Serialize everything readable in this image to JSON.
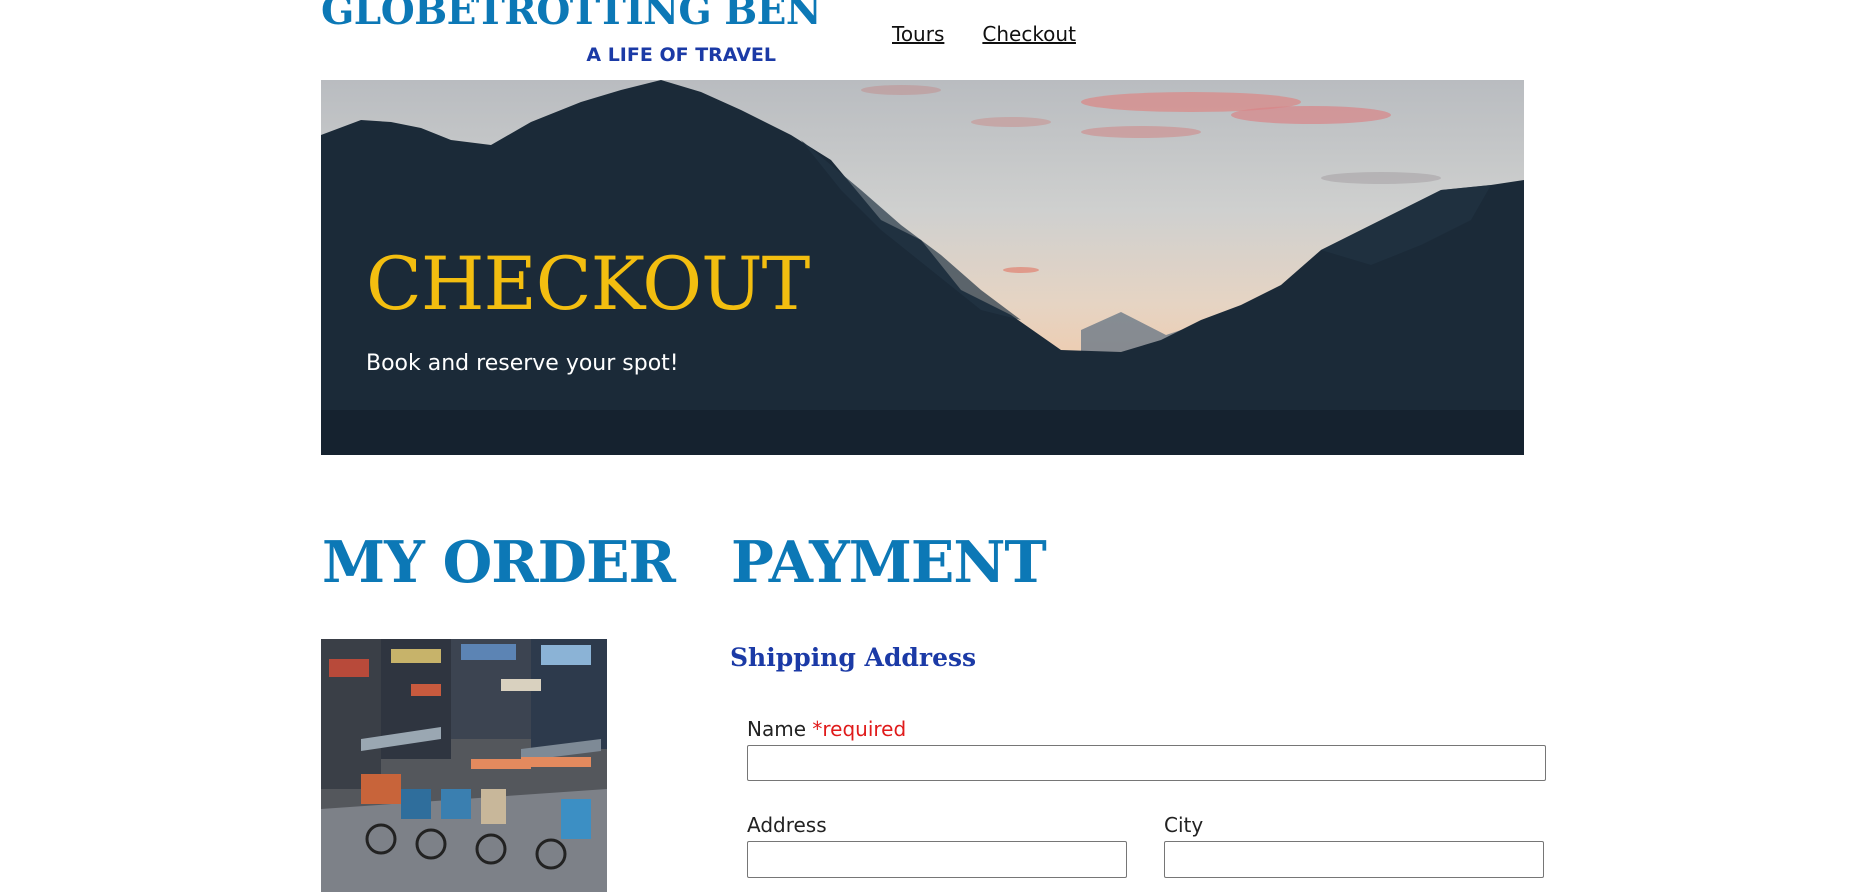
{
  "header": {
    "logo_title": "GLOBETROTTING BEN",
    "logo_subtitle": "A LIFE OF TRAVEL",
    "nav": [
      {
        "label": "Tours"
      },
      {
        "label": "Checkout"
      }
    ]
  },
  "hero": {
    "title": "CHECKOUT",
    "subtitle": "Book and reserve your spot!",
    "image": "mountain-sunset-image"
  },
  "order": {
    "title": "MY ORDER",
    "image": "street-rickshaw-photo"
  },
  "payment": {
    "title": "PAYMENT",
    "shipping_title": "Shipping Address",
    "fields": {
      "name": {
        "label": "Name",
        "required_text": "*required",
        "value": ""
      },
      "address": {
        "label": "Address",
        "value": ""
      },
      "city": {
        "label": "City",
        "value": ""
      }
    }
  },
  "colors": {
    "brand_blue": "#0c78b6",
    "deep_blue": "#1b3aa6",
    "hero_title": "#f3be10",
    "required": "#e01b1b"
  }
}
